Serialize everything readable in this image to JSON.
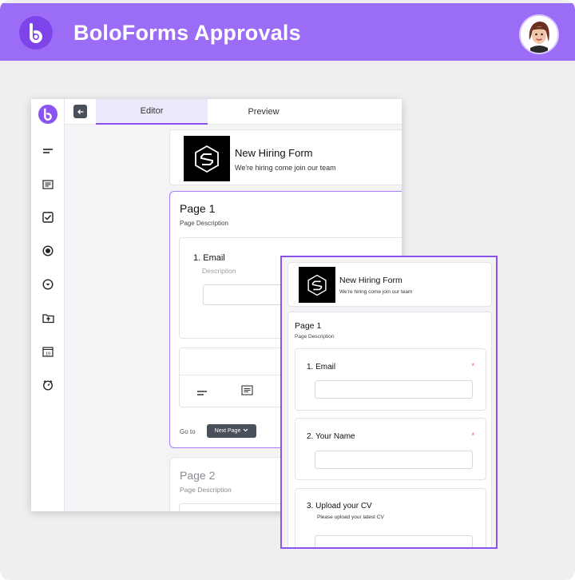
{
  "header": {
    "title": "BoloForms Approvals",
    "logo_icon": "b-logo-icon",
    "avatar_icon": "user-avatar",
    "accent": "#9b6cf6"
  },
  "editor": {
    "tabs": [
      "Editor",
      "Preview"
    ],
    "active_tab": "Editor",
    "sidebar_icons": [
      "short-text-icon",
      "paragraph-icon",
      "checkbox-icon",
      "radio-icon",
      "dropdown-icon",
      "file-upload-icon",
      "date-icon",
      "time-icon"
    ],
    "form": {
      "title": "New Hiring Form",
      "description": "We're hiring come join our team"
    },
    "page1": {
      "title": "Page 1",
      "description": "Page Description",
      "field_label": "1. Email",
      "field_desc_placeholder": "Description",
      "go_to_label": "Go to",
      "next_page_label": "Next Page"
    },
    "page2": {
      "title": "Page 2",
      "description": "Page Description"
    }
  },
  "preview": {
    "form": {
      "title": "New Hiring Form",
      "description": "We're hiring come join our team"
    },
    "page": {
      "title": "Page 1",
      "description": "Page Description"
    },
    "fields": [
      {
        "label": "1. Email",
        "required": "*"
      },
      {
        "label": "2. Your Name",
        "required": "*"
      },
      {
        "label": "3. Upload your CV",
        "help": "Please upload your latest CV"
      }
    ]
  }
}
